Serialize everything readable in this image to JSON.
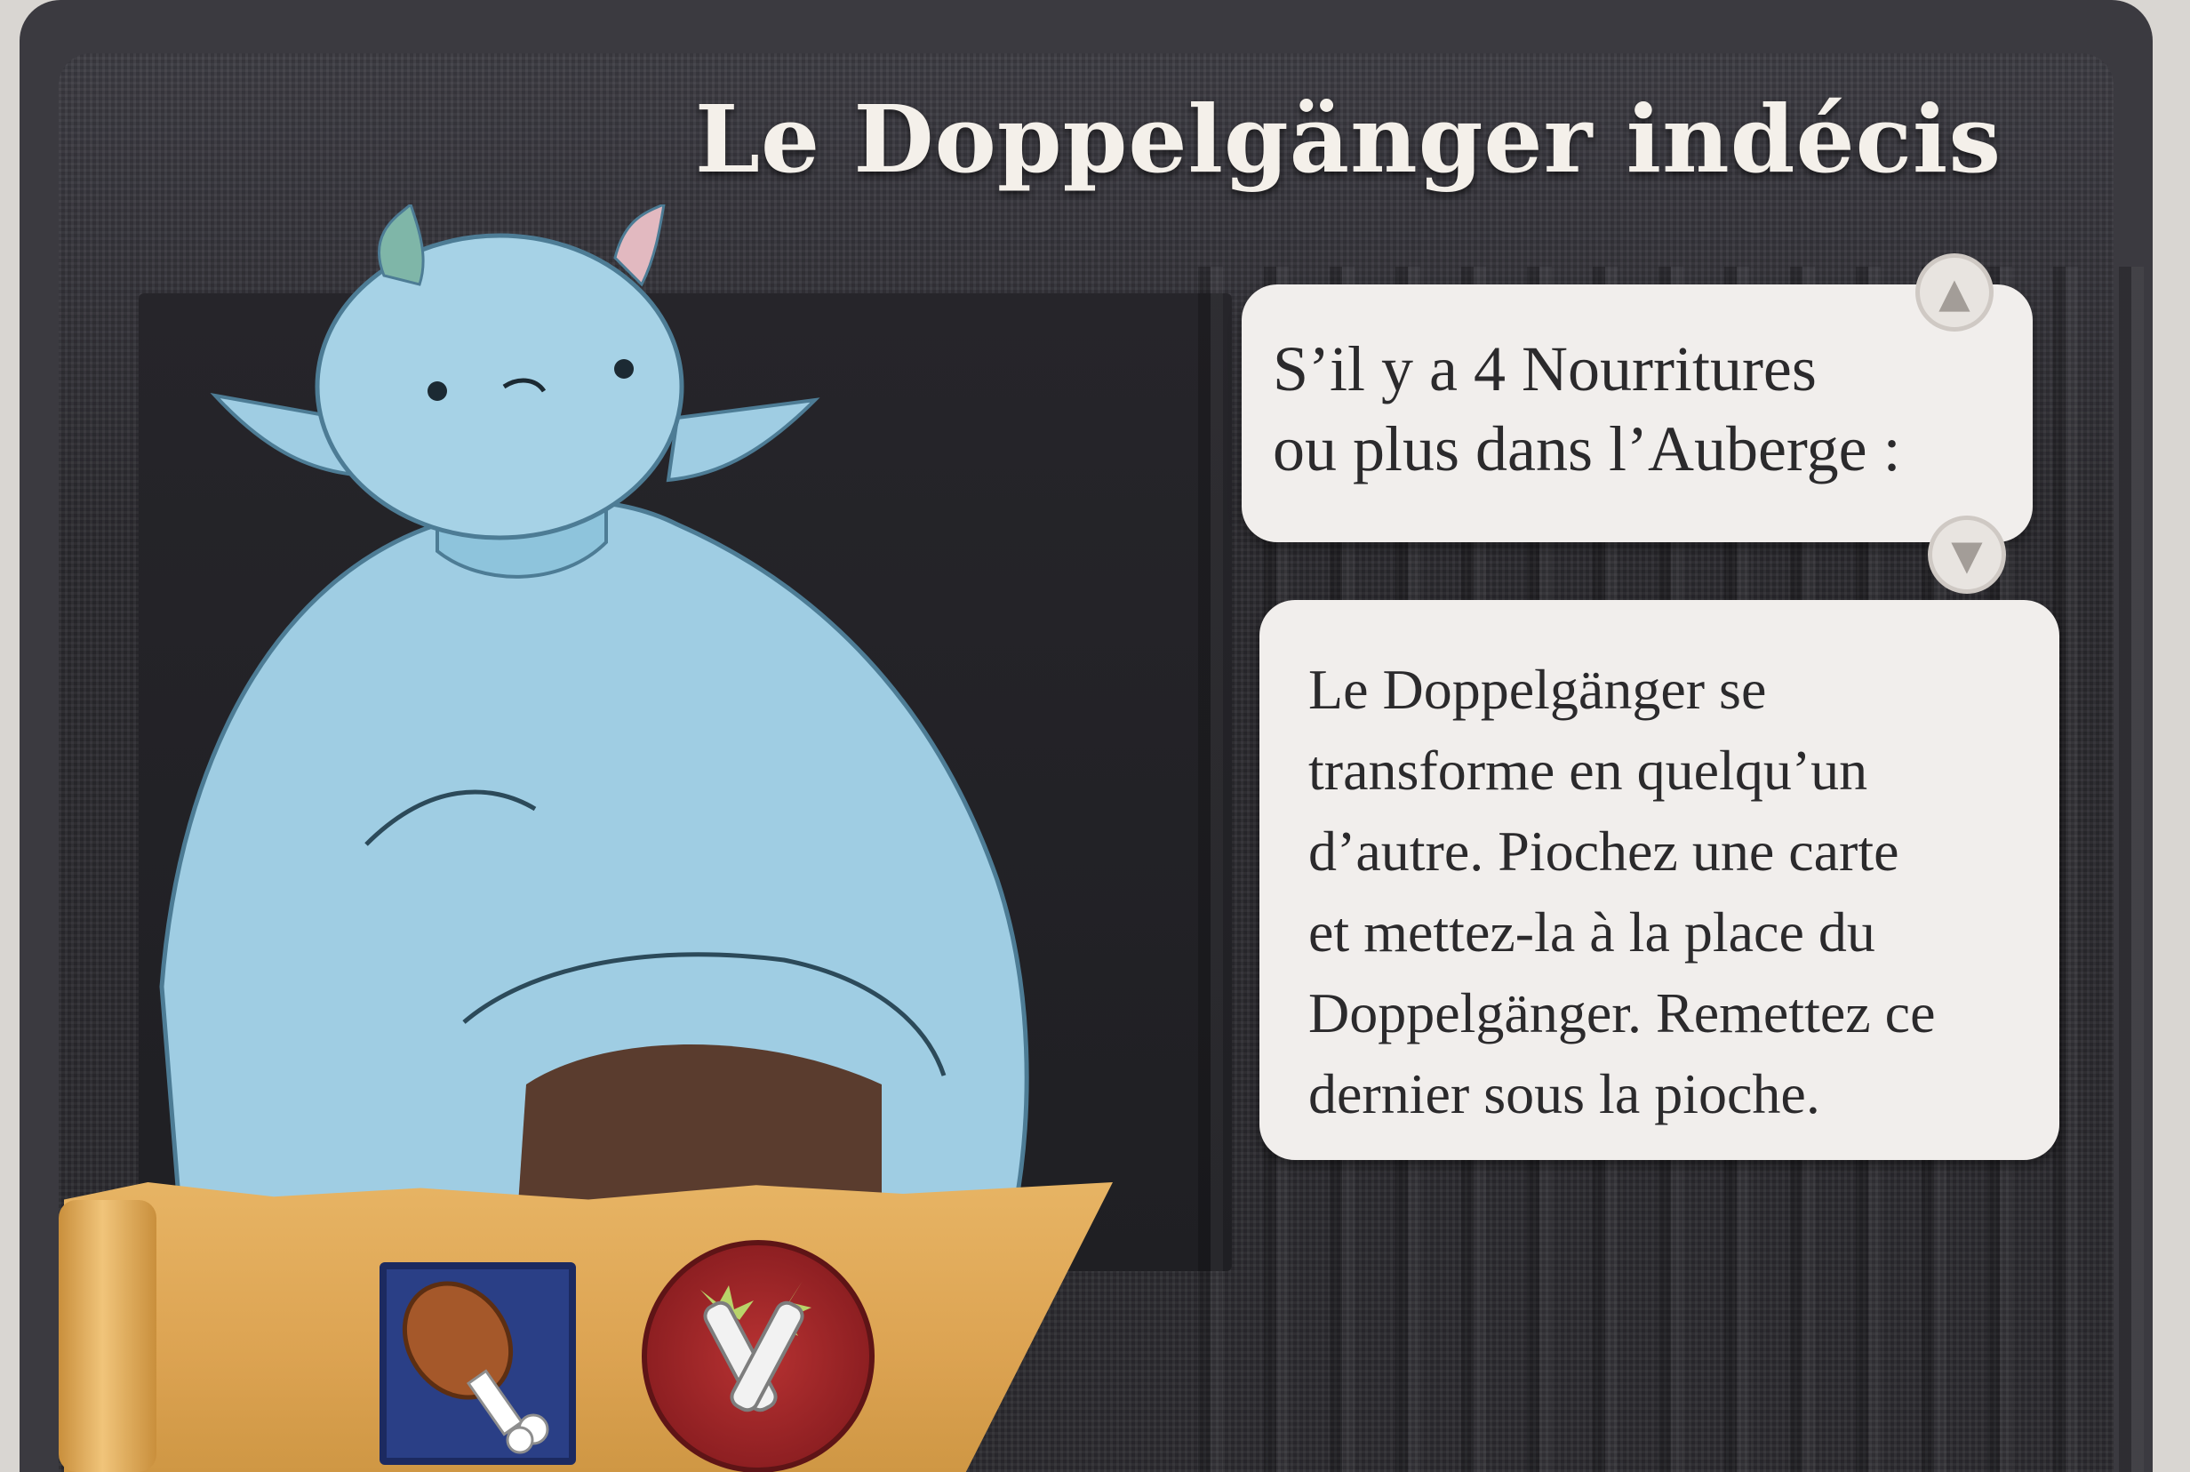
{
  "card": {
    "title": "Le Doppelgänger indécis",
    "condition_lines": [
      "S’il y a 4 Nourritures",
      "ou plus dans l’Auberge :"
    ],
    "effect_lines": [
      "Le Doppelgänger se",
      "transforme en quelqu’un",
      "d’autre. Piochez une carte",
      "et mettez-la à la place du",
      "Doppelgänger. Remettez ce",
      "dernier sous la pioche."
    ]
  },
  "icons": {
    "condition_badge": "arrow-up-icon",
    "effect_badge": "arrow-down-icon",
    "food": "meat-drumstick-icon",
    "combat": "crossed-swords-icon"
  },
  "colors": {
    "card_background": "#2b2a2f",
    "text_box": "#f1eeec",
    "character_skin": "#9fcde3",
    "scroll": "#dca352",
    "food_icon_bg": "#2a3f86",
    "combat_icon_bg": "#8e1f22"
  }
}
